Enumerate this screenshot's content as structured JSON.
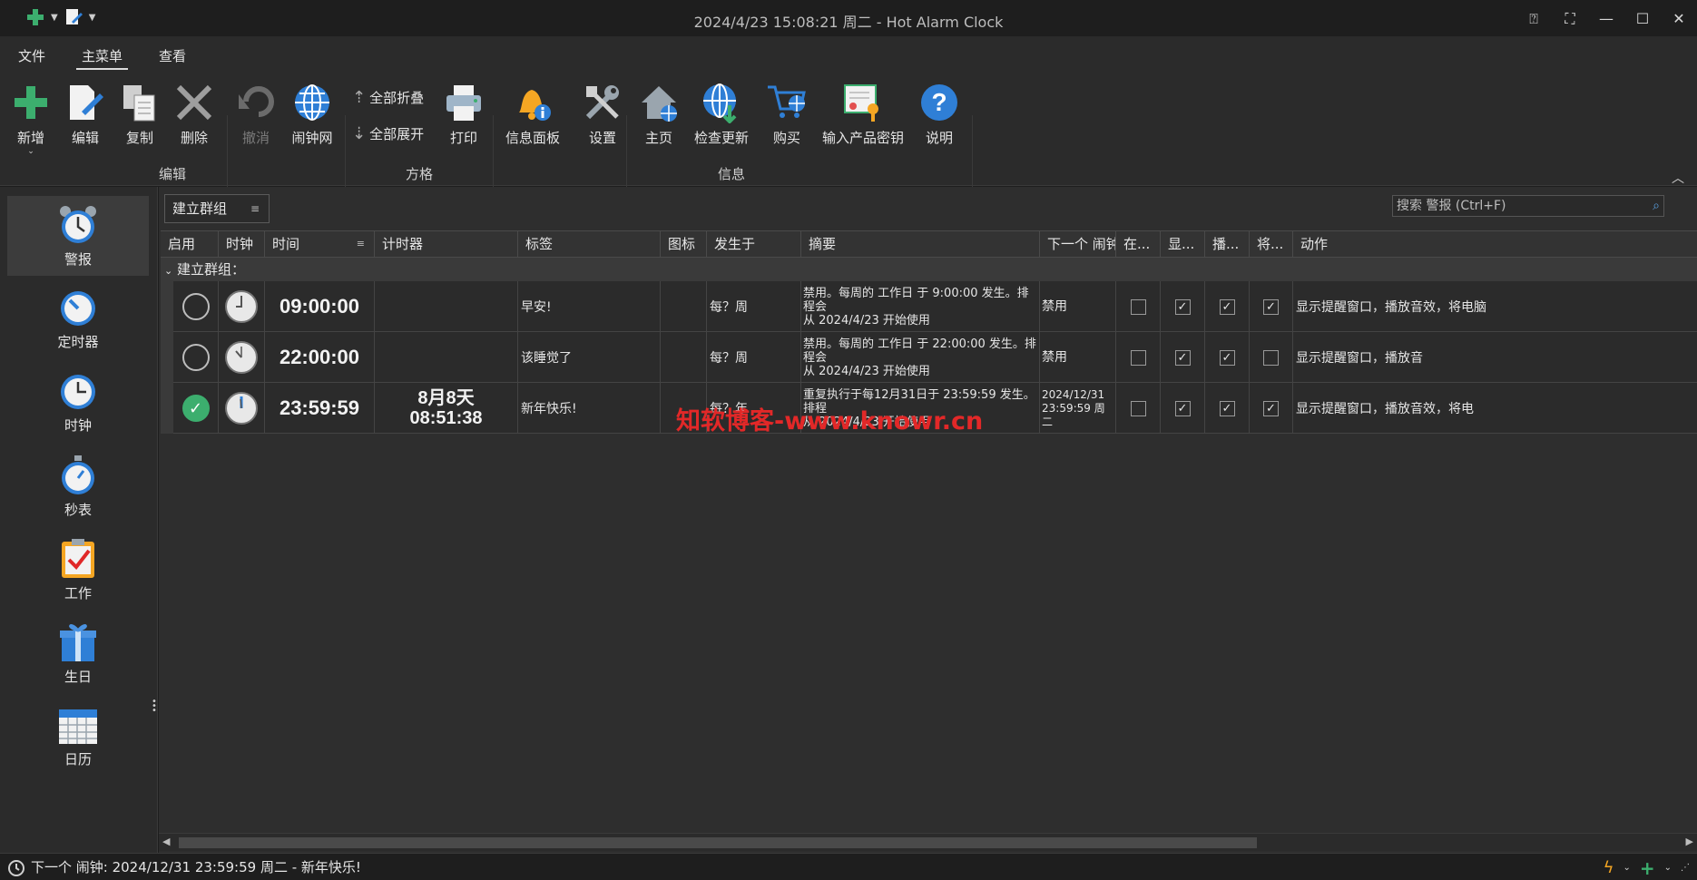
{
  "window": {
    "title": "2024/4/23 15:08:21 周二 - Hot Alarm Clock"
  },
  "ribbon": {
    "tabs": [
      {
        "label": "文件"
      },
      {
        "label": "主菜单"
      },
      {
        "label": "查看"
      }
    ],
    "active_tab": "主菜单",
    "buttons": {
      "new": "新增",
      "edit": "编辑",
      "copy": "复制",
      "delete": "删除",
      "undo": "撤消",
      "alarmweb": "闹钟网",
      "collapse_all": "全部折叠",
      "expand_all": "全部展开",
      "print": "打印",
      "info_panel": "信息面板",
      "settings": "设置",
      "home": "主页",
      "check_update": "检查更新",
      "buy": "购买",
      "enter_key": "输入产品密钥",
      "help": "说明"
    },
    "groups": {
      "edit": "编辑",
      "grid": "方格",
      "info": "信息"
    }
  },
  "sidebar": {
    "items": [
      {
        "label": "警报",
        "icon": "alarm-clock-icon"
      },
      {
        "label": "定时器",
        "icon": "timer-icon"
      },
      {
        "label": "时钟",
        "icon": "clock-icon"
      },
      {
        "label": "秒表",
        "icon": "stopwatch-icon"
      },
      {
        "label": "工作",
        "icon": "task-icon"
      },
      {
        "label": "生日",
        "icon": "gift-icon"
      },
      {
        "label": "日历",
        "icon": "calendar-icon"
      }
    ],
    "active": "警报"
  },
  "toolbar": {
    "group_by": "建立群组",
    "search_placeholder": "搜索 警报 (Ctrl+F)"
  },
  "grid": {
    "columns": [
      "启用",
      "时钟",
      "时间",
      "计时器",
      "标签",
      "图标",
      "发生于",
      "摘要",
      "下一个 闹钟",
      "在...",
      "显...",
      "播...",
      "将...",
      "动作"
    ],
    "group_label": "建立群组：",
    "rows": [
      {
        "enabled": false,
        "time": "09:00:00",
        "timer_line1": "",
        "timer_line2": "",
        "label": "早安!",
        "occurs": "每？周",
        "summary1": "禁用。每周的 工作日 于 9:00:00 发生。排程会",
        "summary2": "从 2024/4/23 开始使用",
        "next1": "禁用",
        "next2": "",
        "checks": [
          false,
          true,
          true,
          true
        ],
        "action": "显示提醒窗口，播放音效，将电脑"
      },
      {
        "enabled": false,
        "time": "22:00:00",
        "timer_line1": "",
        "timer_line2": "",
        "label": "该睡觉了",
        "occurs": "每？周",
        "summary1": "禁用。每周的 工作日 于 22:00:00 发生。排程会",
        "summary2": "从 2024/4/23 开始使用",
        "next1": "禁用",
        "next2": "",
        "checks": [
          false,
          true,
          true,
          false
        ],
        "action": "显示提醒窗口，播放音"
      },
      {
        "enabled": true,
        "time": "23:59:59",
        "timer_line1": "8月8天",
        "timer_line2": "08:51:38",
        "label": "新年快乐!",
        "occurs": "每？年",
        "summary1": "重复执行于每12月31日于 23:59:59 发生。排程",
        "summary2": "从 2024/4/23 开始使用",
        "next1": "2024/12/31",
        "next2": "23:59:59 周二",
        "checks": [
          false,
          true,
          true,
          true
        ],
        "action": "显示提醒窗口，播放音效，将电"
      }
    ]
  },
  "watermark": "知软博客-www.knowr.cn",
  "status": {
    "text": "下一个 闹钟:  2024/12/31 23:59:59 周二 - 新年快乐!"
  },
  "colors": {
    "accent_green": "#3cae6e",
    "accent_blue": "#2f7fd6",
    "watermark_red": "#e22828"
  }
}
